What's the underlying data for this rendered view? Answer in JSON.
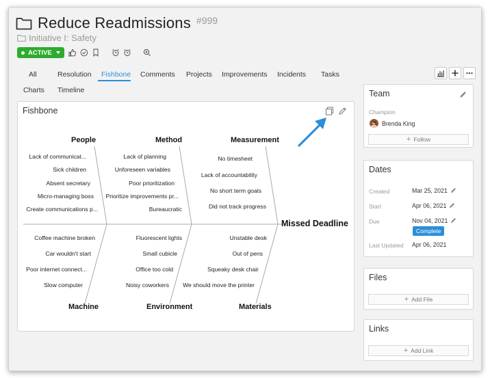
{
  "header": {
    "title": "Reduce Readmissions",
    "id": "#999",
    "initiative": "Initiative I: Safety",
    "status": "ACTIVE"
  },
  "tabs": [
    "All",
    "Resolution",
    "Fishbone",
    "Comments",
    "Projects",
    "Improvements",
    "Incidents",
    "Tasks",
    "Charts",
    "Timeline"
  ],
  "active_tab": "Fishbone",
  "fishbone": {
    "panel_title": "Fishbone",
    "effect": "Missed Deadline",
    "top_categories": [
      {
        "name": "People",
        "causes": [
          "Lack of communicat...",
          "Sick children",
          "Absent secretary",
          "Micro-managing boss",
          "Create communications p..."
        ]
      },
      {
        "name": "Method",
        "causes": [
          "Lack of planning",
          "Unforeseen variables",
          "Poor prioritization",
          "Prioritize improvements pr...",
          "Bureaucratic"
        ]
      },
      {
        "name": "Measurement",
        "causes": [
          "No timesheet",
          "Lack of accountability",
          "No short term goals",
          "Did not track progress"
        ]
      }
    ],
    "bottom_categories": [
      {
        "name": "Machine",
        "causes": [
          "Coffee machine broken",
          "Car wouldn't start",
          "Poor internet connect...",
          "Slow computer"
        ]
      },
      {
        "name": "Environment",
        "causes": [
          "Fluorescent lights",
          "Small cubicle",
          "Office too cold",
          "Noisy coworkers"
        ]
      },
      {
        "name": "Materials",
        "causes": [
          "Unstable desk",
          "Out of pens",
          "Squeaky desk chair",
          "We should move the printer"
        ]
      }
    ]
  },
  "team": {
    "title": "Team",
    "champion_label": "Champion",
    "champion_name": "Brenda King",
    "follow_label": "Follow"
  },
  "dates": {
    "title": "Dates",
    "created_label": "Created",
    "created": "Mar 25, 2021",
    "start_label": "Start",
    "start": "Apr 06, 2021",
    "due_label": "Due",
    "due": "Nov 04, 2021",
    "complete_label": "Complete",
    "updated_label": "Last Updated",
    "updated": "Apr 06, 2021"
  },
  "files": {
    "title": "Files",
    "add_label": "Add File"
  },
  "links": {
    "title": "Links",
    "add_label": "Add Link"
  },
  "colors": {
    "accent": "#2b8fd8",
    "active_green": "#2eab2e"
  }
}
